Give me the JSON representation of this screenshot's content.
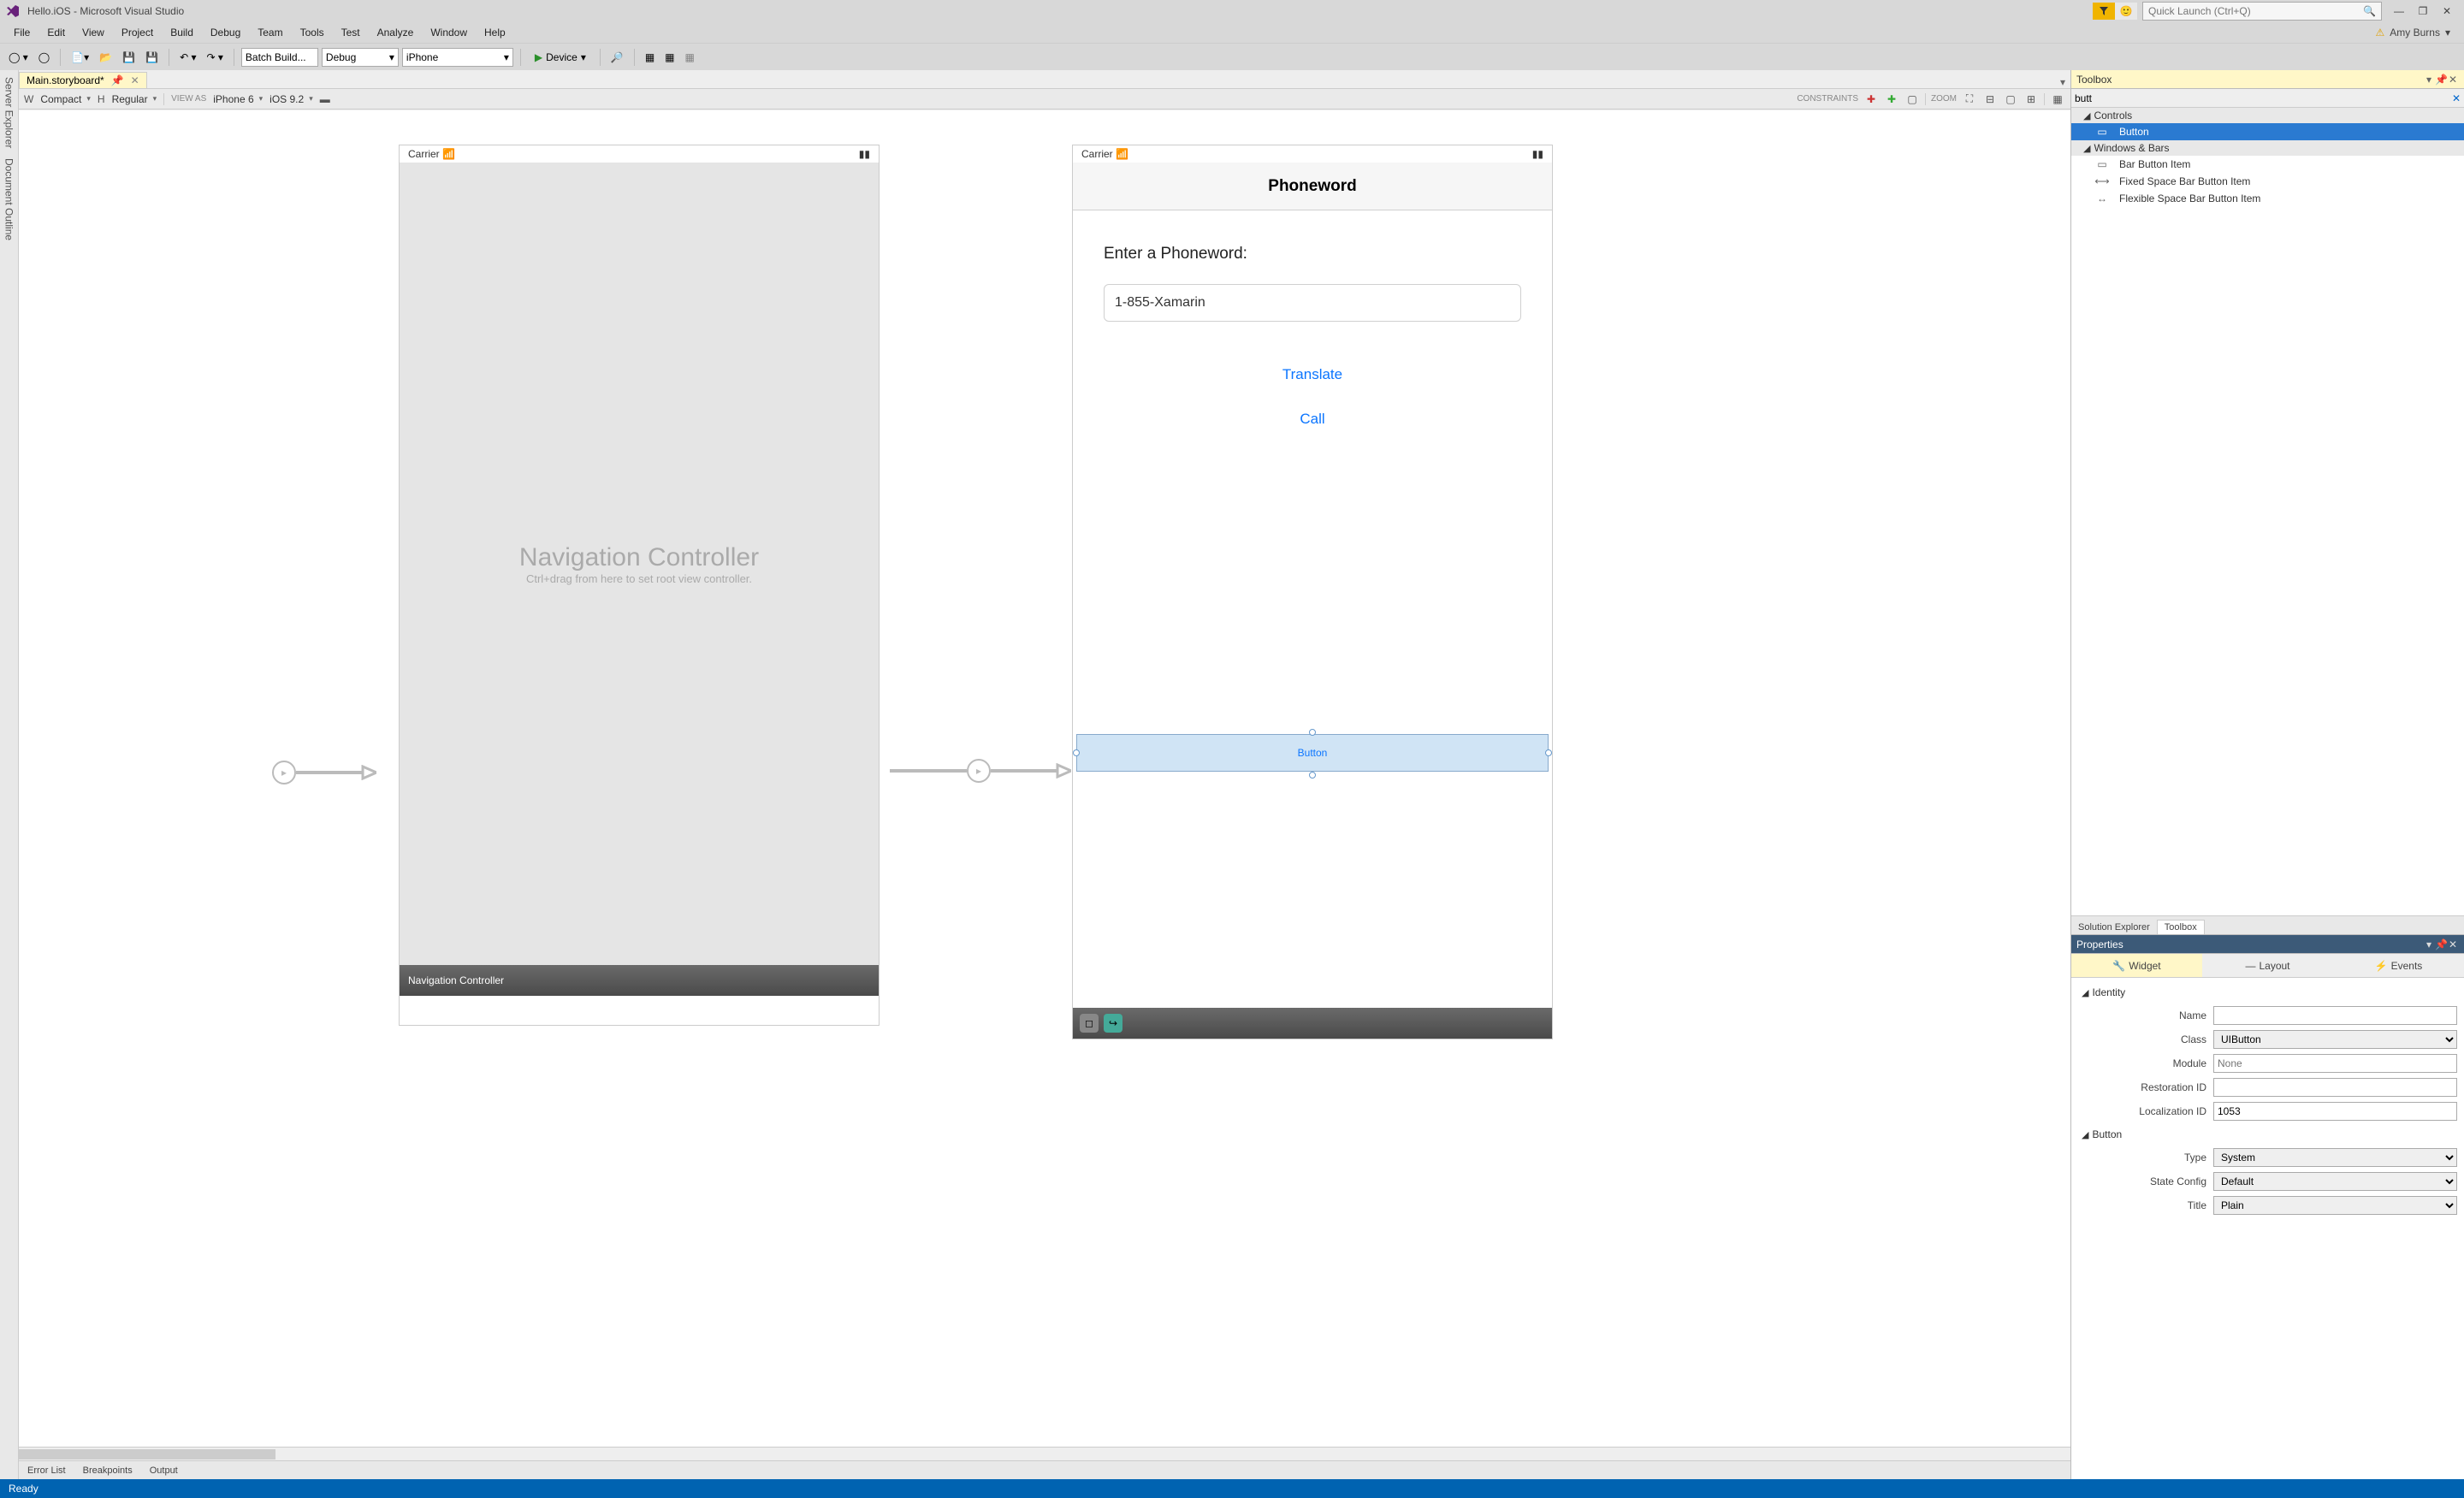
{
  "titlebar": {
    "title": "Hello.iOS - Microsoft Visual Studio",
    "quick_launch_placeholder": "Quick Launch (Ctrl+Q)"
  },
  "menubar": {
    "items": [
      "File",
      "Edit",
      "View",
      "Project",
      "Build",
      "Debug",
      "Team",
      "Tools",
      "Test",
      "Analyze",
      "Window",
      "Help"
    ],
    "user": "Amy Burns"
  },
  "toolbar": {
    "batch_build": "Batch Build...",
    "config": "Debug",
    "platform": "iPhone",
    "device": "Device"
  },
  "doctab": {
    "label": "Main.storyboard*"
  },
  "designer_bar": {
    "size_w": "W",
    "size_w_val": "Compact",
    "size_h": "H",
    "size_h_val": "Regular",
    "view_as": "VIEW AS",
    "device": "iPhone 6",
    "ios": "iOS 9.2",
    "constraints": "CONSTRAINTS",
    "zoom": "ZOOM"
  },
  "left_gutter": {
    "tab1": "Server Explorer",
    "tab2": "Document Outline"
  },
  "canvas": {
    "carrier": "Carrier",
    "nav_controller_title": "Navigation Controller",
    "nav_controller_sub": "Ctrl+drag from here to set root view controller.",
    "nav_controller_footer": "Navigation Controller",
    "phoneword_title": "Phoneword",
    "enter_label": "Enter a Phoneword:",
    "textfield_value": "1-855-Xamarin",
    "translate_btn": "Translate",
    "call_btn": "Call",
    "new_button": "Button"
  },
  "bottom_tabs": {
    "t1": "Error List",
    "t2": "Breakpoints",
    "t3": "Output"
  },
  "status": {
    "text": "Ready"
  },
  "toolbox": {
    "title": "Toolbox",
    "search": "butt",
    "groups": {
      "controls": "Controls",
      "windows_bars": "Windows & Bars"
    },
    "items": {
      "button": "Button",
      "bar_button_item": "Bar Button Item",
      "fixed_space": "Fixed Space Bar Button Item",
      "flexible_space": "Flexible Space Bar Button Item"
    },
    "right_tabs": {
      "solution_explorer": "Solution Explorer",
      "toolbox": "Toolbox"
    }
  },
  "properties": {
    "title": "Properties",
    "tabs": {
      "widget": "Widget",
      "layout": "Layout",
      "events": "Events"
    },
    "groups": {
      "identity": "Identity",
      "button": "Button"
    },
    "fields": {
      "name_lbl": "Name",
      "name_val": "",
      "class_lbl": "Class",
      "class_placeholder": "UIButton",
      "module_lbl": "Module",
      "module_placeholder": "None",
      "restoration_lbl": "Restoration ID",
      "restoration_val": "",
      "localization_lbl": "Localization ID",
      "localization_val": "1053",
      "type_lbl": "Type",
      "type_val": "System",
      "state_lbl": "State Config",
      "state_val": "Default",
      "title_lbl": "Title",
      "title_val": "Plain"
    }
  }
}
